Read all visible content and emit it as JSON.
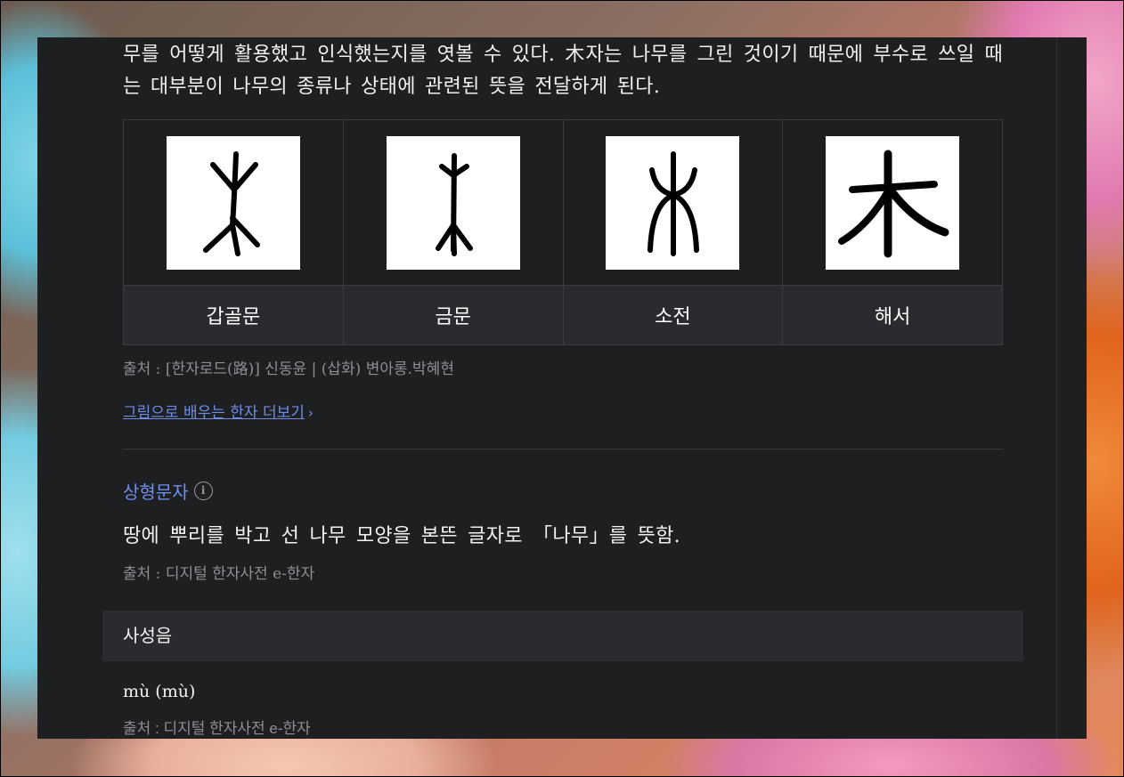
{
  "intro_text": "무를 어떻게 활용했고 인식했는지를 엿볼 수 있다. 木자는 나무를 그린 것이기 때문에 부수로 쓰일 때는 대부분이 나무의 종류나 상태에 관련된 뜻을 전달하게 된다.",
  "script_forms": [
    {
      "label": "갑골문",
      "icon": "oracle-bone-mu-glyph"
    },
    {
      "label": "금문",
      "icon": "bronze-mu-glyph"
    },
    {
      "label": "소전",
      "icon": "seal-mu-glyph"
    },
    {
      "label": "해서",
      "icon": "regular-mu-glyph"
    }
  ],
  "script_source": "출처 : [한자로드(路)] 신동윤 | (삽화) 변아롱.박혜현",
  "more_link": {
    "label": "그림으로 배우는 한자 더보기",
    "chevron": "›"
  },
  "formation": {
    "type": "상형문자",
    "info_icon": "i",
    "meaning": "땅에 뿌리를 박고 선 나무 모양을 본뜬 글자로 「나무」를 뜻함.",
    "source": "출처 : 디지털 한자사전 e-한자"
  },
  "tone": {
    "header": "사성음",
    "value": "mù (mù)",
    "source": "출처 : 디지털 한자사전 e-한자"
  },
  "colors": {
    "panel_bg": "#1e1f21",
    "label_bg": "#2a2b2e",
    "link": "#6d8ee8",
    "type_title": "#6f8ff0",
    "muted": "#8d8f93"
  }
}
